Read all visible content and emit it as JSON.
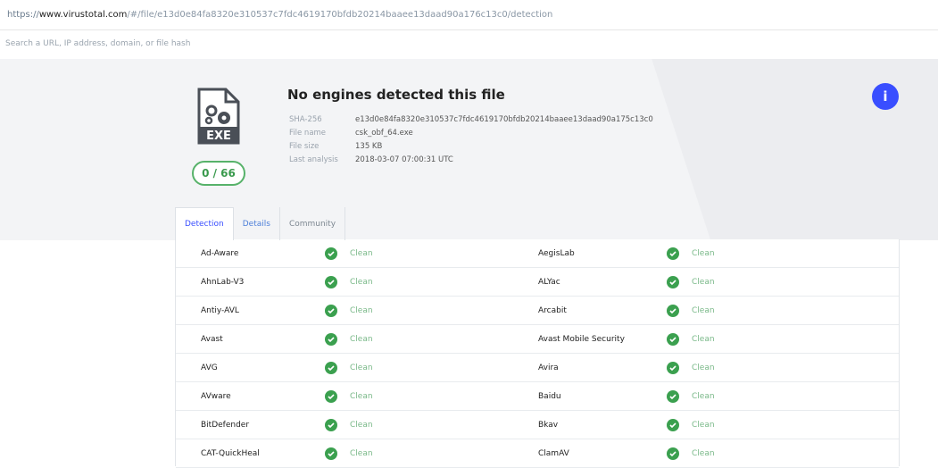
{
  "browser": {
    "url_scheme": "https://",
    "url_host": "www.virustotal.com",
    "url_path": "/#/file/e13d0e84fa8320e310537c7fdc4619170bfdb20214baaee13daad90a176c13c0/detection"
  },
  "search": {
    "placeholder": "Search a URL, IP address, domain, or file hash"
  },
  "summary": {
    "title": "No engines detected this file",
    "score": "0 / 66",
    "file_type": "EXE",
    "fields": [
      {
        "key": "SHA-256",
        "value": "e13d0e84fa8320e310537c7fdc4619170bfdb20214baaee13daad90a175c13c0"
      },
      {
        "key": "File name",
        "value": "csk_obf_64.exe"
      },
      {
        "key": "File size",
        "value": "135 KB"
      },
      {
        "key": "Last analysis",
        "value": "2018-03-07 07:00:31 UTC"
      }
    ]
  },
  "info_button": "i",
  "tabs": [
    "Detection",
    "Details",
    "Community"
  ],
  "colors": {
    "accent": "#394eff",
    "clean": "#3ba04f",
    "score_ring": "#57b26a"
  },
  "detections": [
    {
      "left_engine": "Ad-Aware",
      "left_status": "Clean",
      "right_engine": "AegisLab",
      "right_status": "Clean"
    },
    {
      "left_engine": "AhnLab-V3",
      "left_status": "Clean",
      "right_engine": "ALYac",
      "right_status": "Clean"
    },
    {
      "left_engine": "Antiy-AVL",
      "left_status": "Clean",
      "right_engine": "Arcabit",
      "right_status": "Clean"
    },
    {
      "left_engine": "Avast",
      "left_status": "Clean",
      "right_engine": "Avast Mobile Security",
      "right_status": "Clean"
    },
    {
      "left_engine": "AVG",
      "left_status": "Clean",
      "right_engine": "Avira",
      "right_status": "Clean"
    },
    {
      "left_engine": "AVware",
      "left_status": "Clean",
      "right_engine": "Baidu",
      "right_status": "Clean"
    },
    {
      "left_engine": "BitDefender",
      "left_status": "Clean",
      "right_engine": "Bkav",
      "right_status": "Clean"
    },
    {
      "left_engine": "CAT-QuickHeal",
      "left_status": "Clean",
      "right_engine": "ClamAV",
      "right_status": "Clean"
    }
  ]
}
